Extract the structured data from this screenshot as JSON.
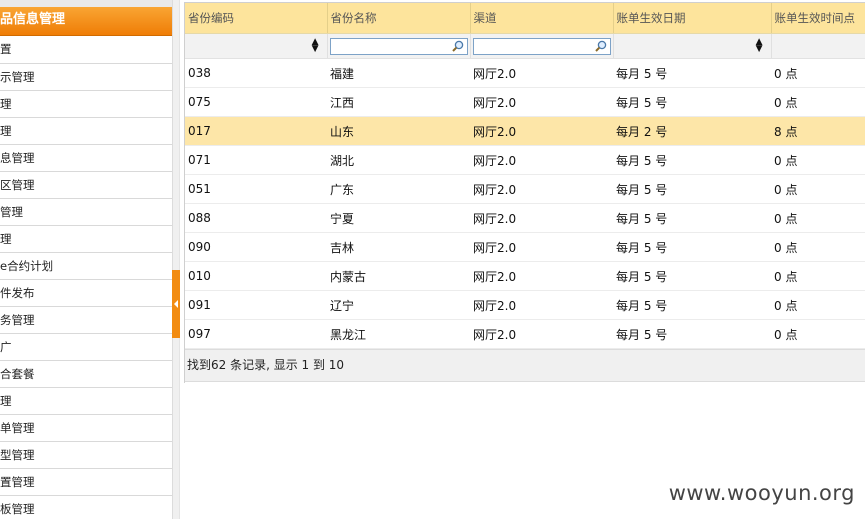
{
  "sidebar": {
    "header": "品信息管理",
    "items": [
      {
        "label": "置"
      },
      {
        "label": "示管理"
      },
      {
        "label": "理"
      },
      {
        "label": "理"
      },
      {
        "label": "息管理"
      },
      {
        "label": "区管理"
      },
      {
        "label": "管理"
      },
      {
        "label": "理"
      },
      {
        "label": "e合约计划"
      },
      {
        "label": "件发布"
      },
      {
        "label": "务管理"
      },
      {
        "label": "广"
      },
      {
        "label": "合套餐"
      },
      {
        "label": "理"
      },
      {
        "label": "单管理"
      },
      {
        "label": "型管理"
      },
      {
        "label": "置管理"
      },
      {
        "label": "板管理"
      }
    ]
  },
  "grid": {
    "columns": [
      "省份编码",
      "省份名称",
      "渠道",
      "账单生效日期",
      "账单生效时间点"
    ],
    "rows": [
      [
        "038",
        "福建",
        "网厅2.0",
        "每月 5 号",
        "0 点"
      ],
      [
        "075",
        "江西",
        "网厅2.0",
        "每月 5 号",
        "0 点"
      ],
      [
        "017",
        "山东",
        "网厅2.0",
        "每月 2 号",
        "8 点"
      ],
      [
        "071",
        "湖北",
        "网厅2.0",
        "每月 5 号",
        "0 点"
      ],
      [
        "051",
        "广东",
        "网厅2.0",
        "每月 5 号",
        "0 点"
      ],
      [
        "088",
        "宁夏",
        "网厅2.0",
        "每月 5 号",
        "0 点"
      ],
      [
        "090",
        "吉林",
        "网厅2.0",
        "每月 5 号",
        "0 点"
      ],
      [
        "010",
        "内蒙古",
        "网厅2.0",
        "每月 5 号",
        "0 点"
      ],
      [
        "091",
        "辽宁",
        "网厅2.0",
        "每月 5 号",
        "0 点"
      ],
      [
        "097",
        "黑龙江",
        "网厅2.0",
        "每月 5 号",
        "0 点"
      ]
    ],
    "selected_row": 2,
    "pager_text": "找到62 条记录, 显示 1 到 10"
  },
  "icons": {
    "filter_sort": "updown-arrows-icon",
    "filter_search": "magnifier-icon",
    "splitter": "collapse-left-icon"
  },
  "colors": {
    "sidebar_header": "#ef7d06",
    "header_bg": "#fde49c",
    "selected_row": "#fde6a8",
    "accent": "#f28c12"
  },
  "watermark": "www.wooyun.org"
}
